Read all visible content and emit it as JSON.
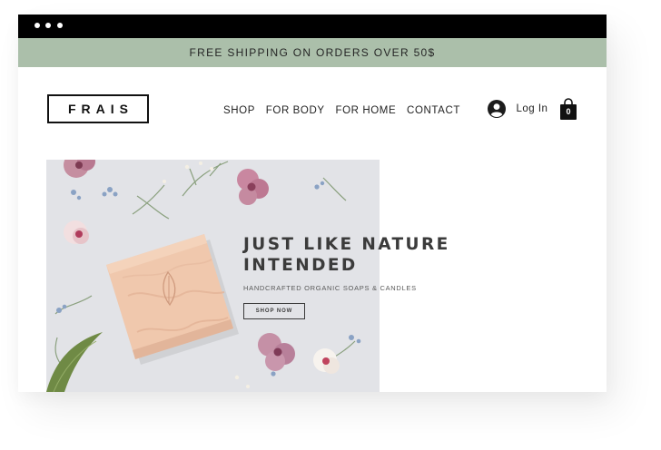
{
  "window": {
    "controls": [
      "dot",
      "dot",
      "dot"
    ]
  },
  "promo": {
    "text": "FREE SHIPPING ON ORDERS OVER 50$"
  },
  "header": {
    "logo": "FRAIS",
    "nav": [
      {
        "label": "SHOP"
      },
      {
        "label": "FOR BODY"
      },
      {
        "label": "FOR HOME"
      },
      {
        "label": "CONTACT"
      }
    ],
    "login_label": "Log In",
    "login_icon": "user-avatar-icon",
    "cart_icon": "shopping-bag-icon",
    "cart_count": "0"
  },
  "hero": {
    "headline_line1": "JUST LIKE NATURE",
    "headline_line2": "INTENDED",
    "subline": "HANDCRAFTED ORGANIC SOAPS & CANDLES",
    "cta_label": "SHOP NOW"
  },
  "colors": {
    "titlebar": "#000000",
    "promo_bg": "#abbfaa",
    "text_dark": "#222222",
    "hero_bg": "#e4e5e8"
  }
}
